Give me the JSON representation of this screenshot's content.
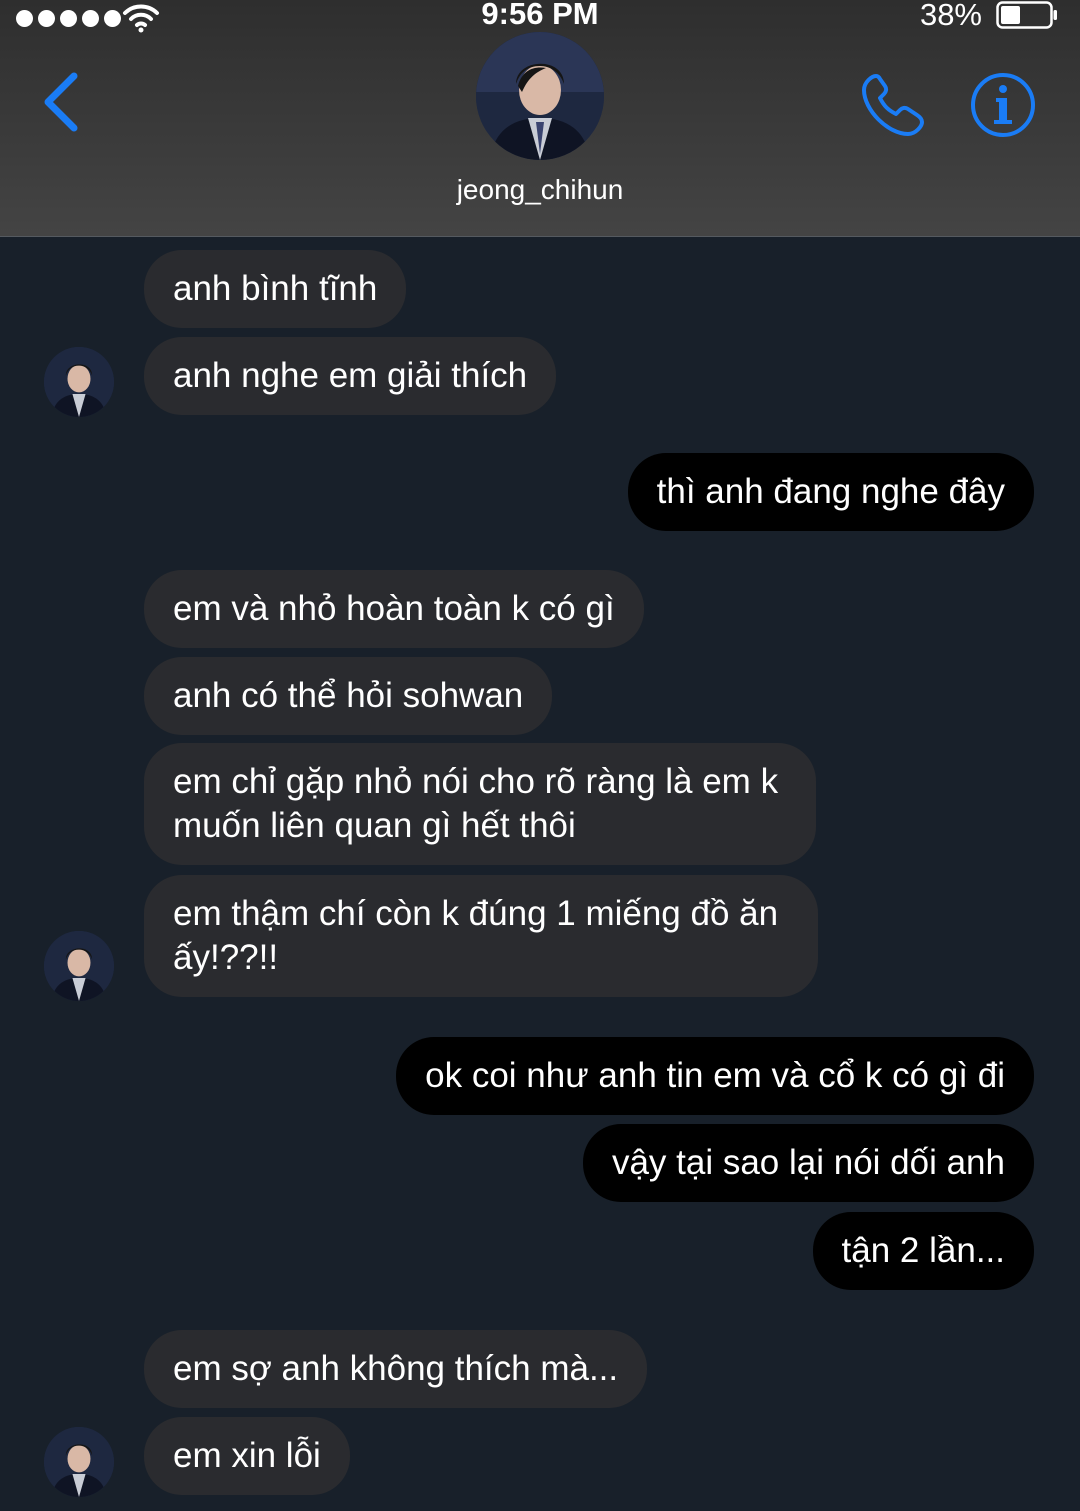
{
  "status_bar": {
    "time": "9:56 PM",
    "battery": "38%",
    "signal_icon": "signal-dots-icon",
    "wifi_icon": "wifi-icon",
    "battery_icon": "battery-icon"
  },
  "header": {
    "contact_name": "jeong_chihun",
    "back_icon": "chevron-left-icon",
    "call_icon": "phone-icon",
    "info_icon": "info-icon",
    "accent_color": "#1a7cf5"
  },
  "messages": [
    {
      "side": "in",
      "text": "anh bình tĩnh"
    },
    {
      "side": "in",
      "text": "anh nghe em giải thích"
    },
    {
      "side": "out",
      "text": "thì anh đang nghe đây"
    },
    {
      "side": "in",
      "text": "em và nhỏ hoàn toàn k có gì"
    },
    {
      "side": "in",
      "text": "anh có thể hỏi sohwan"
    },
    {
      "side": "in",
      "text": "em chỉ gặp nhỏ nói cho rõ ràng là em k muốn liên quan gì hết thôi"
    },
    {
      "side": "in",
      "text": "em thậm chí còn k đúng 1 miếng đồ ăn ấy!??!!"
    },
    {
      "side": "out",
      "text": "ok coi như anh tin em và cổ k có gì đi"
    },
    {
      "side": "out",
      "text": "vậy tại sao lại nói dối anh"
    },
    {
      "side": "out",
      "text": "tận 2 lần..."
    },
    {
      "side": "in",
      "text": "em sợ anh không thích mà..."
    },
    {
      "side": "in",
      "text": "em xin lỗi"
    }
  ],
  "colors": {
    "background": "#18202a",
    "incoming_bubble": "#2a2b2f",
    "outgoing_bubble": "#000000"
  }
}
